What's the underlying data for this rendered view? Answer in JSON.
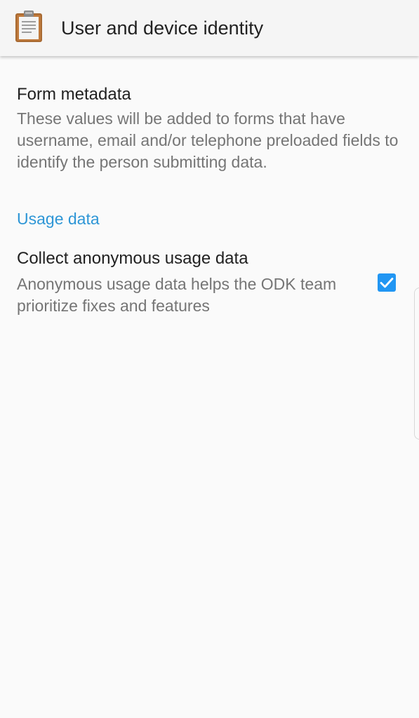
{
  "app_bar": {
    "icon": "clipboard-icon",
    "title": "User and device identity"
  },
  "preferences": {
    "form_metadata": {
      "title": "Form metadata",
      "summary": "These values will be added to forms that have username, email and/or telephone preloaded fields to identify the person submitting data."
    },
    "usage_category": {
      "title": "Usage data"
    },
    "collect_usage": {
      "title": "Collect anonymous usage data",
      "summary": "Anonymous usage data helps the ODK team prioritize fixes and features",
      "checked": true
    }
  },
  "colors": {
    "accent": "#2e96d6",
    "checkbox": "#2196f3",
    "title_text": "#212121",
    "summary_text": "#757575",
    "background": "#fafafa",
    "app_bar": "#f5f5f5"
  }
}
